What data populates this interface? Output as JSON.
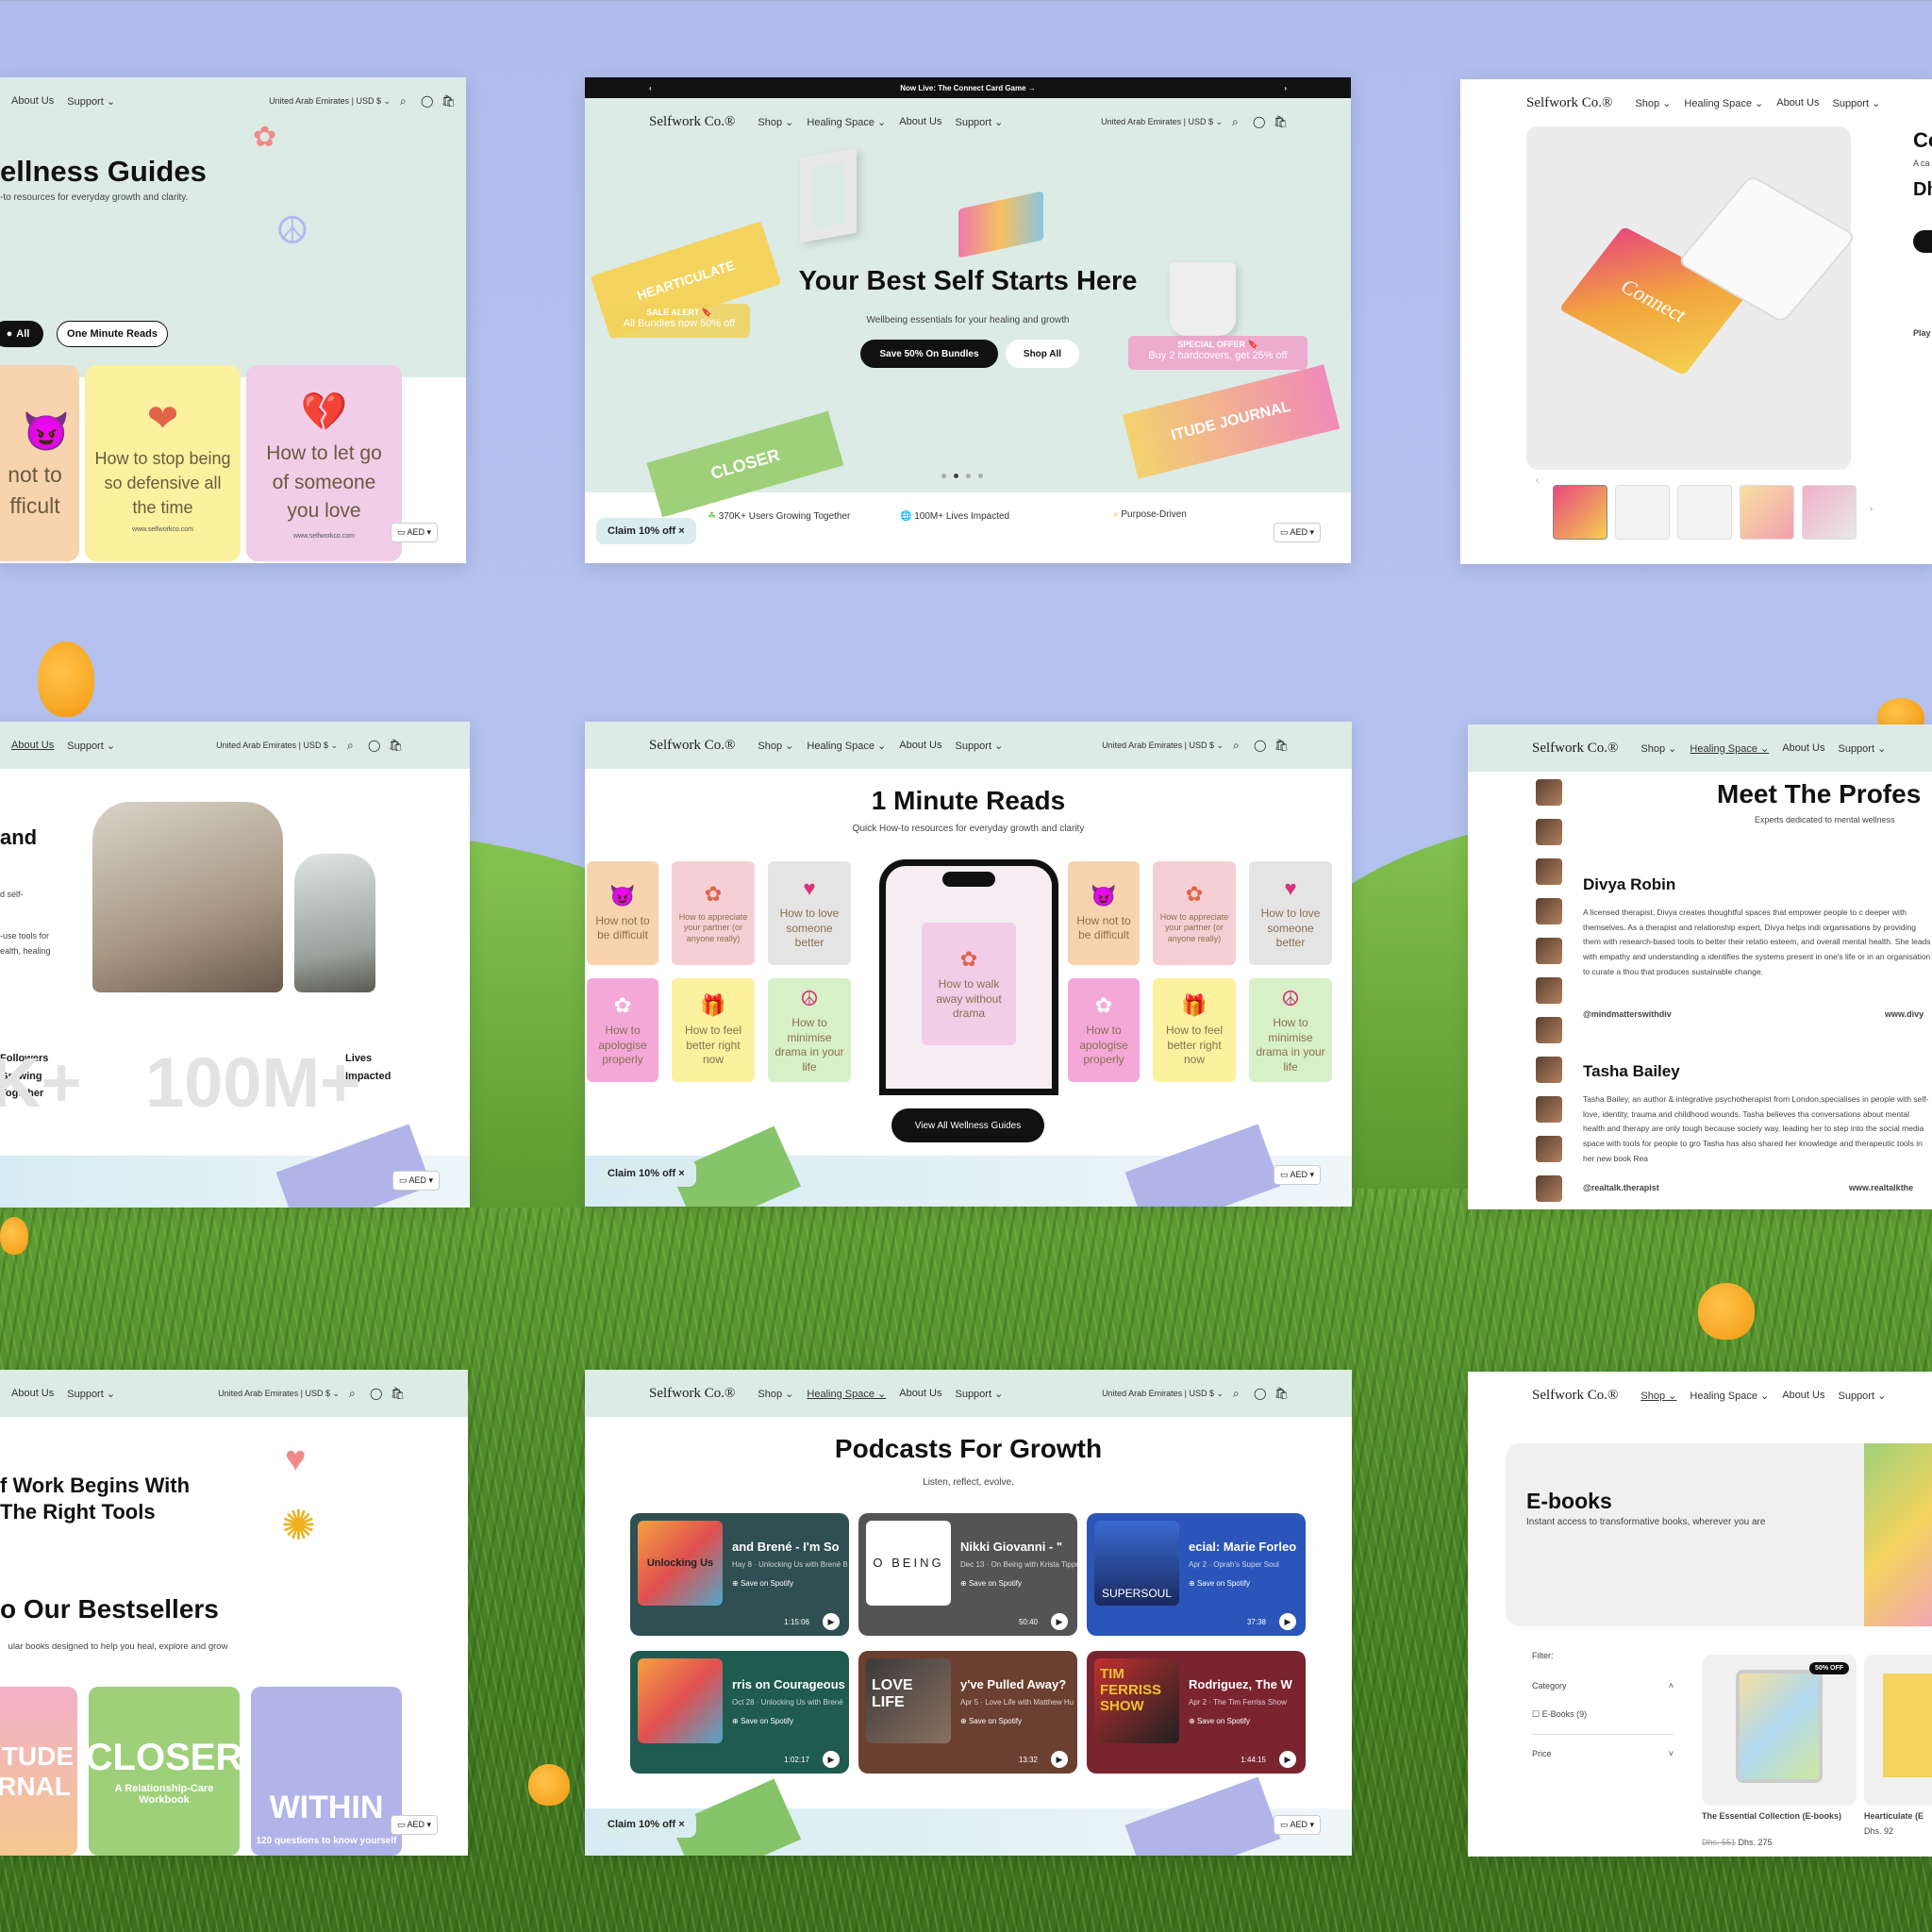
{
  "brand": "Selfwork Co.®",
  "nav": {
    "shop": "Shop",
    "healing": "Healing Space",
    "about": "About Us",
    "support": "Support",
    "region": "United Arab Emirates | USD $"
  },
  "common": {
    "claim": "Claim 10% off",
    "aed": "AED"
  },
  "icons": [
    "search-icon",
    "account-icon",
    "cart-icon",
    "chevron-down-icon",
    "close-icon",
    "play-icon",
    "spotify-icon",
    "flag-icon"
  ],
  "colors": {
    "background": "#b1bcec",
    "mint": "#dcebe6",
    "dark": "#111111"
  },
  "p1": {
    "title": "ellness Guides",
    "subtitle": "-to resources for everyday growth and clarity.",
    "filter_all": "All",
    "filter_minute": "One Minute Reads",
    "cards": [
      {
        "text": "not to fficult"
      },
      {
        "text": "How to stop being so defensive all the time",
        "url": "www.selfworkco.com"
      },
      {
        "text": "How to let go of someone you love",
        "url": "www.selfworkco.com"
      }
    ]
  },
  "p2": {
    "banner": "Now Live: The Connect Card Game →",
    "title": "Your Best Self Starts Here",
    "subtitle": "Wellbeing essentials for your healing and growth",
    "btn_bundles": "Save 50% On Bundles",
    "btn_shop": "Shop All",
    "sale_alert": "SALE ALERT 🔖",
    "sale_text": "All Bundles now 50% off",
    "special": "SPECIAL OFFER 🔖",
    "special_text": "Buy 2 hardcovers, get 25% off",
    "stats": [
      "370K+ Users Growing Together",
      "100M+ Lives Impacted",
      "Purpose-Driven"
    ]
  },
  "p3": {
    "title": "Co",
    "sub": "A ca",
    "title2": "Dh",
    "play": "Play",
    "connect": "Connect"
  },
  "p4": {
    "heading": "and",
    "line1": "d self-",
    "line2": "-use tools for",
    "line3": "ealth, healing",
    "followers": "Followers Growing Together",
    "big": "100M+",
    "bigleft": "K+",
    "lives": "Lives Impacted"
  },
  "p5": {
    "title": "1 Minute Reads",
    "subtitle": "Quick How-to resources for everyday growth and clarity",
    "cards": [
      "How not to be difficult",
      "How to appreciate your partner (or anyone really)",
      "How to love someone better",
      "How to apologise properly",
      "How to feel better right now",
      "How to minimise drama in your life"
    ],
    "phone_card": "How to walk away without drama",
    "btn": "View All Wellness Guides"
  },
  "p6": {
    "title": "Meet The Profes",
    "subtitle": "Experts dedicated to mental wellness",
    "people": [
      {
        "name": "Divya Robin",
        "bio": "A licensed therapist, Divya creates thoughtful spaces that empower people to c deeper with themselves. As a therapist and relationship expert, Divya helps indi organisations by providing them with research-based tools to better their relatio esteem, and overall mental health. She leads with empathy and understanding a identifies the systems present in one's life or in an organisation to curate a thou that produces sustainable change.",
        "handle": "@mindmatterswithdiv",
        "web": "www.divy"
      },
      {
        "name": "Tasha Bailey",
        "bio": "Tasha Bailey, an author & integrative psychotherapist from London,specialises in people with self-love, identity, trauma and childhood wounds. Tasha believes tha conversations about mental health and therapy are only tough because society way, leading her to step into the social media space with tools for people to gro Tasha has also shared her knowledge and therapeutic tools in her new book Rea",
        "handle": "@realtalk.therapist",
        "web": "www.realtalkthe"
      }
    ]
  },
  "p7": {
    "heading1": "f Work Begins With",
    "heading2": "The Right Tools",
    "best": "o Our Bestsellers",
    "sub": "ular books designed to help you heal, explore and grow",
    "books": [
      "ITUDE RNAL",
      "CLOSER",
      "WITHIN"
    ],
    "closer_sub": "A Relationship-Care Workbook",
    "within_sub": "120 questions to know yourself"
  },
  "p8": {
    "title": "Podcasts For Growth",
    "subtitle": "Listen, reflect, evolve.",
    "save": "Save on Spotify",
    "pods": [
      {
        "title": "and Brené - I'm So",
        "desc": "Hay 8 · Unlocking Us with Brené B",
        "time": "1:15:06",
        "art": "Unlocking Us"
      },
      {
        "title": "Nikki Giovanni - \"",
        "desc": "Dec 13 · On Being with Krista Tippe",
        "time": "50:40",
        "art": "O BEING"
      },
      {
        "title": "ecial: Marie Forleo",
        "desc": "Apr 2 · Oprah's Super Soul",
        "time": "37:38",
        "art": "SUPERSOUL"
      },
      {
        "title": "rris on Courageous",
        "desc": "Oct 28 · Unlocking Us with Brené",
        "time": "1:02:17",
        "art": ""
      },
      {
        "title": "y've Pulled Away?",
        "desc": "Apr 5 · Love Life with Matthew Hu",
        "time": "13:32",
        "art": "LOVE LIFE"
      },
      {
        "title": "Rodriguez, The W",
        "desc": "Apr 2 · The Tim Ferriss Show",
        "time": "1:44:15",
        "art": "TIM FERRISS SHOW"
      }
    ]
  },
  "p9": {
    "title": "E-books",
    "subtitle": "Instant access to transformative books, wherever you are",
    "filter": "Filter:",
    "category": "Category",
    "ebooks": "E-Books (9)",
    "price": "Price",
    "product1": "The Essential Collection (E-books)",
    "badge": "50% OFF",
    "old": "Dhs. 551",
    "new": "Dhs. 275",
    "product2": "Hearticulate (E",
    "price2": "Dhs. 92"
  }
}
